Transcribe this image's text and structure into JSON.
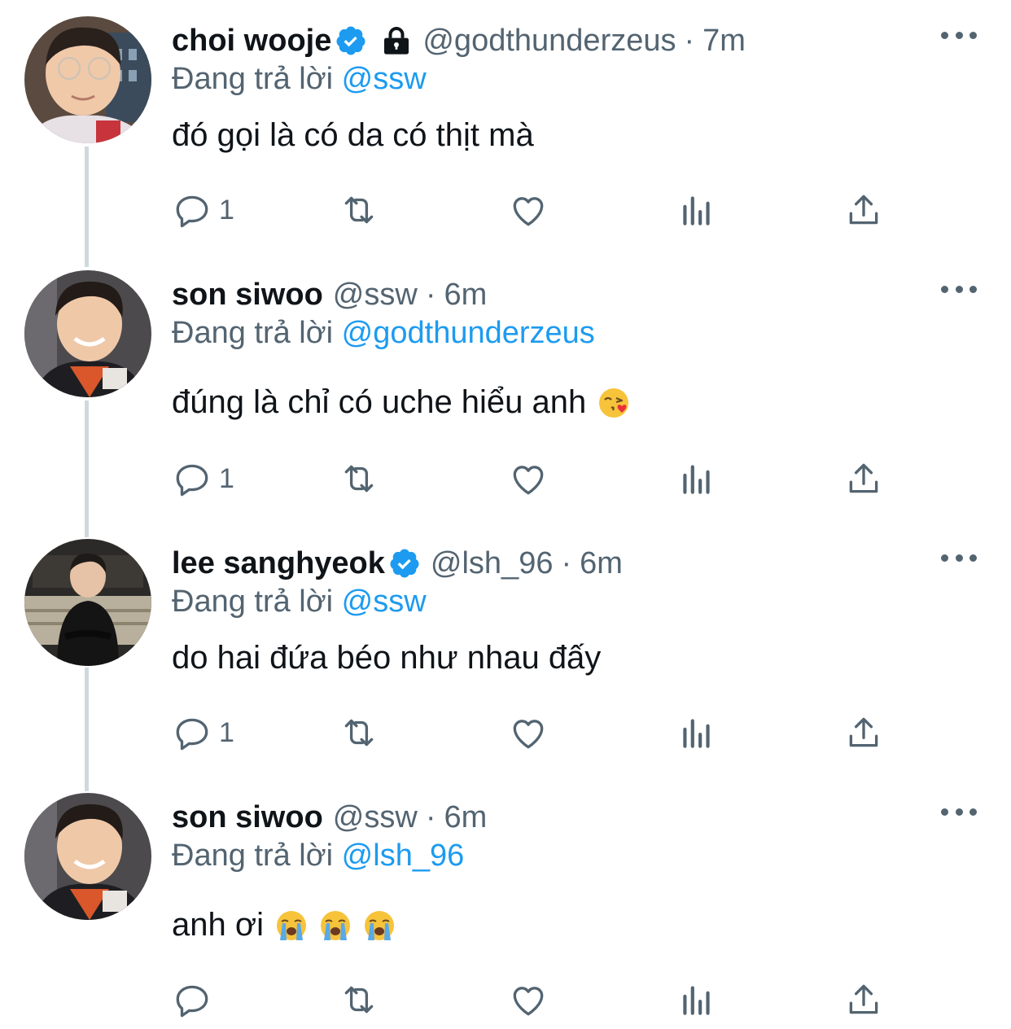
{
  "tweets": [
    {
      "name": "choi wooje",
      "verified": true,
      "protected": true,
      "handle": "@godthunderzeus",
      "separator": "·",
      "time": "7m",
      "replying_prefix": "Đang trả lời",
      "replying_to": "@ssw",
      "text": "đó gọi là có da có thịt mà",
      "emojis": [],
      "reply_count": "1"
    },
    {
      "name": "son siwoo",
      "verified": false,
      "protected": false,
      "handle": "@ssw",
      "separator": "·",
      "time": "6m",
      "replying_prefix": "Đang trả lời",
      "replying_to": "@godthunderzeus",
      "text": "đúng là chỉ có uche hiểu anh",
      "emojis": [
        "face-blowing-kiss"
      ],
      "reply_count": "1"
    },
    {
      "name": "lee sanghyeok",
      "verified": true,
      "protected": false,
      "handle": "@lsh_96",
      "separator": "·",
      "time": "6m",
      "replying_prefix": "Đang trả lời",
      "replying_to": "@ssw",
      "text": "do hai đứa béo như nhau đấy",
      "emojis": [],
      "reply_count": "1"
    },
    {
      "name": "son siwoo",
      "verified": false,
      "protected": false,
      "handle": "@ssw",
      "separator": "·",
      "time": "6m",
      "replying_prefix": "Đang trả lời",
      "replying_to": "@lsh_96",
      "text": "anh ơi",
      "emojis": [
        "loudly-crying-face",
        "loudly-crying-face",
        "loudly-crying-face"
      ],
      "reply_count": ""
    }
  ],
  "colors": {
    "text": "#0f1419",
    "secondary": "#536471",
    "accent": "#1d9bf0",
    "thread_line": "#cfd9de"
  },
  "icons": {
    "verified": "verified-badge-icon",
    "protected": "lock-icon",
    "more": "more-icon",
    "reply": "reply-icon",
    "retweet": "retweet-icon",
    "like": "heart-icon",
    "views": "views-icon",
    "share": "share-icon"
  }
}
